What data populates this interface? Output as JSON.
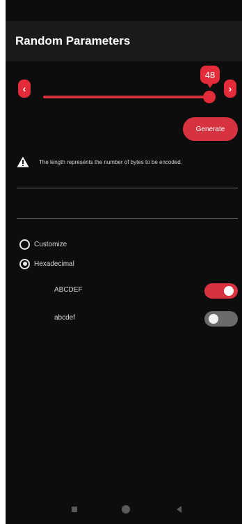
{
  "app": {
    "title": "Random Parameters"
  },
  "slider": {
    "value": "48",
    "decrease_icon": "chevron-left-icon",
    "increase_icon": "chevron-right-icon"
  },
  "actions": {
    "generate_label": "Generate"
  },
  "info": {
    "icon": "warning-icon",
    "text": "The length represents the number of bytes to be encoded."
  },
  "options": {
    "mode": [
      {
        "label": "Customize",
        "checked": false
      },
      {
        "label": "Hexadecimal",
        "checked": true
      }
    ],
    "toggles": [
      {
        "label": "ABCDEF",
        "on": true
      },
      {
        "label": "abcdef",
        "on": false
      }
    ]
  },
  "colors": {
    "accent": "#d7323f",
    "background": "#0d0d0d",
    "app_bar": "#1a1a1a"
  }
}
